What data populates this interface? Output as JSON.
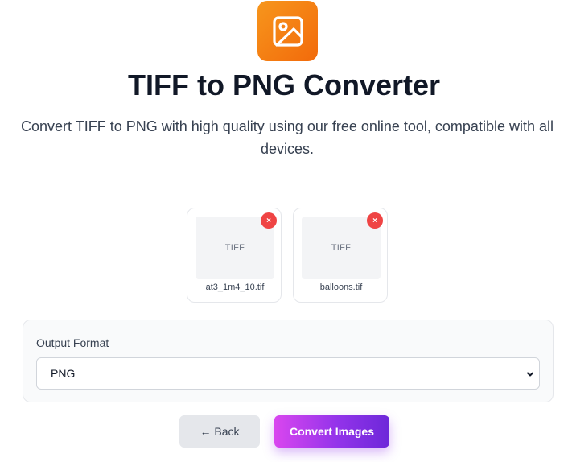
{
  "header": {
    "logo_icon": "image-icon",
    "title": "TIFF to PNG Converter",
    "subtitle": "Convert TIFF to PNG with high quality using our free online tool, compatible with all devices."
  },
  "files": [
    {
      "thumb_label": "TIFF",
      "name": "at3_1m4_10.tif",
      "remove_symbol": "×"
    },
    {
      "thumb_label": "TIFF",
      "name": "balloons.tif",
      "remove_symbol": "×"
    }
  ],
  "output": {
    "label": "Output Format",
    "selected": "PNG"
  },
  "actions": {
    "back_label": "← Back",
    "convert_label": "Convert Images"
  },
  "colors": {
    "logo": "#f26a0b",
    "remove": "#ef4444",
    "convert_start": "#d946ef",
    "convert_end": "#6d28d9"
  }
}
